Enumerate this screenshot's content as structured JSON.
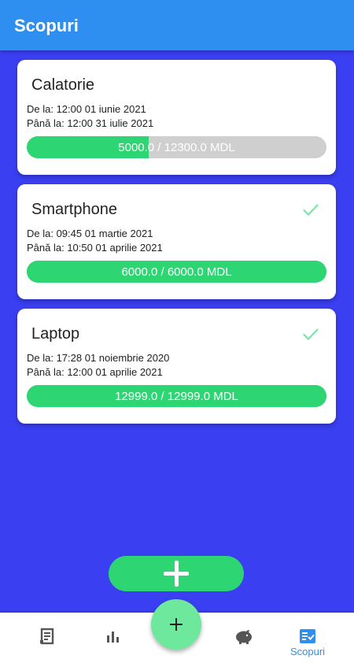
{
  "app_bar": {
    "title": "Scopuri"
  },
  "goals": [
    {
      "name": "Calatorie",
      "from": "De la: 12:00 01 iunie 2021",
      "to": "Până la: 12:00 31 iulie 2021",
      "progress": "5000.0 / 12300.0 MDL",
      "fraction": 0.4065,
      "completed": false
    },
    {
      "name": "Smartphone",
      "from": "De la:  09:45 01 martie 2021",
      "to": "Până la: 10:50 01 aprilie 2021",
      "progress": "6000.0 / 6000.0 MDL",
      "fraction": 1.0,
      "completed": true
    },
    {
      "name": "Laptop",
      "from": "De la:  17:28 01 noiembrie 2020",
      "to": "Până la: 12:00 01 aprilie 2021",
      "progress": "12999.0 / 12999.0 MDL",
      "fraction": 1.0,
      "completed": true
    }
  ],
  "fab": {
    "add_goal_icon": "plus-icon",
    "add_icon": "plus-icon"
  },
  "bottom_nav": {
    "items": [
      {
        "icon": "receipt-icon",
        "label": ""
      },
      {
        "icon": "bar-chart-icon",
        "label": ""
      },
      {
        "icon": "piggy-bank-icon",
        "label": ""
      },
      {
        "icon": "checklist-icon",
        "label": "Scopuri",
        "active": true
      }
    ]
  },
  "colors": {
    "background": "#3a3ff2",
    "app_bar": "#2f8ff0",
    "progress_fill": "#2ed573",
    "progress_track": "#cfcfcf",
    "check": "#7ee2a8",
    "active_nav": "#2f8ff0",
    "fab_round": "#6ee89c"
  }
}
